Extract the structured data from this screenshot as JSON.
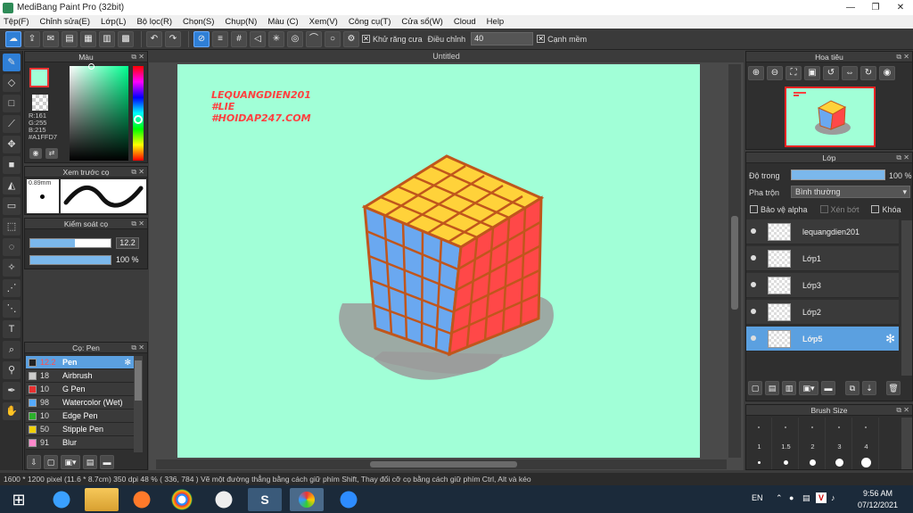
{
  "window": {
    "title": "MediBang Paint Pro (32bit)",
    "minimize": "—",
    "maximize": "❐",
    "close": "✕"
  },
  "menu": [
    "Tệp(F)",
    "Chỉnh sửa(E)",
    "Lớp(L)",
    "Bộ lọc(R)",
    "Chọn(S)",
    "Chụp(N)",
    "Màu (C)",
    "Xem(V)",
    "Công cụ(T)",
    "Cửa sổ(W)",
    "Cloud",
    "Help"
  ],
  "toolbar": {
    "antialias_label": "Khử răng cưa",
    "adjust_label": "Điều chỉnh",
    "adjust_value": "40",
    "edge_label": "Cạnh mềm"
  },
  "color_panel": {
    "title": "Màu",
    "r": "R:161",
    "g": "G:255",
    "b": "B:215",
    "hex": "#A1FFD7",
    "fg_color": "#a1ffd7"
  },
  "brush_preview": {
    "title": "Xem trước cọ",
    "size": "0.89mm"
  },
  "brush_control": {
    "title": "Kiểm soát cọ",
    "size_value": "12.2",
    "opacity_value": "100 %",
    "size_fraction": 0.55,
    "opacity_fraction": 1.0
  },
  "brush_list": {
    "title": "Cọ: Pen",
    "items": [
      {
        "num": "12.2",
        "name": "Pen",
        "color": "#222222",
        "selected": true
      },
      {
        "num": "18",
        "name": "Airbrush",
        "color": "#cccccc",
        "selected": false
      },
      {
        "num": "10",
        "name": "G Pen",
        "color": "#e83030",
        "selected": false
      },
      {
        "num": "98",
        "name": "Watercolor (Wet)",
        "color": "#55aaff",
        "selected": false
      },
      {
        "num": "10",
        "name": "Edge Pen",
        "color": "#2bb02b",
        "selected": false
      },
      {
        "num": "50",
        "name": "Stipple Pen",
        "color": "#f0d000",
        "selected": false
      },
      {
        "num": "91",
        "name": "Blur",
        "color": "#ff88cc",
        "selected": false
      }
    ]
  },
  "document": {
    "tab": "Untitled",
    "text_lines": [
      "LEQUANGDIEN201",
      "#LIE",
      "#HOIDAP247.COM"
    ]
  },
  "navigator": {
    "title": "Hoa tiêu"
  },
  "layer_panel": {
    "title": "Lớp",
    "opacity_label": "Độ trong",
    "opacity_value": "100 %",
    "blend_label": "Pha trộn",
    "blend_value": "Bình thường",
    "protect_alpha": "Bảo vệ alpha",
    "clipping": "Xén bớt",
    "lock": "Khóa",
    "layers": [
      {
        "name": "lequangdien201",
        "selected": false
      },
      {
        "name": "Lớp1",
        "selected": false
      },
      {
        "name": "Lớp3",
        "selected": false
      },
      {
        "name": "Lớp2",
        "selected": false
      },
      {
        "name": "Lớp5",
        "selected": true
      }
    ]
  },
  "brush_size": {
    "title": "Brush Size",
    "sizes": [
      "1",
      "1.5",
      "2",
      "3",
      "4"
    ]
  },
  "status": {
    "text": "1600 * 1200 pixel   (11.6 * 8.7cm)   350 dpi   48 %   ( 336, 784 )   Vẽ một đường thẳng bằng cách giữ phím Shift, Thay đổi cỡ cọ bằng cách giữ phím Ctrl, Alt và kéo"
  },
  "taskbar": {
    "lang": "EN",
    "time": "9:56 AM",
    "date": "07/12/2021"
  }
}
